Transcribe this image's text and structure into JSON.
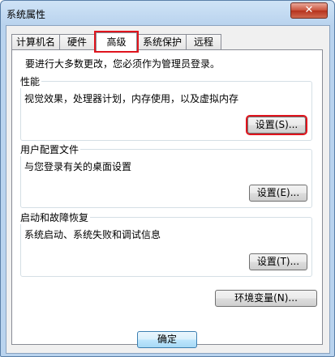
{
  "window": {
    "title": "系统属性",
    "close_glyph": "✕"
  },
  "tabs": [
    {
      "label": "计算机名"
    },
    {
      "label": "硬件"
    },
    {
      "label": "高级"
    },
    {
      "label": "系统保护"
    },
    {
      "label": "远程"
    }
  ],
  "advanced": {
    "admin_prompt": "要进行大多数更改，您必须作为管理员登录。",
    "performance": {
      "title": "性能",
      "description": "视觉效果，处理器计划，内存使用，以及虚拟内存",
      "button": "设置(S)..."
    },
    "user_profiles": {
      "title": "用户配置文件",
      "description": "与您登录有关的桌面设置",
      "button": "设置(E)..."
    },
    "startup_recovery": {
      "title": "启动和故障恢复",
      "description": "系统启动、系统失败和调试信息",
      "button": "设置(T)..."
    },
    "env_button": "环境变量(N)..."
  },
  "footer": {
    "ok_button": "确定"
  },
  "colors": {
    "highlight": "#e0141d",
    "panel_bg": "#ffffff",
    "frame": "#b9d3ee"
  }
}
